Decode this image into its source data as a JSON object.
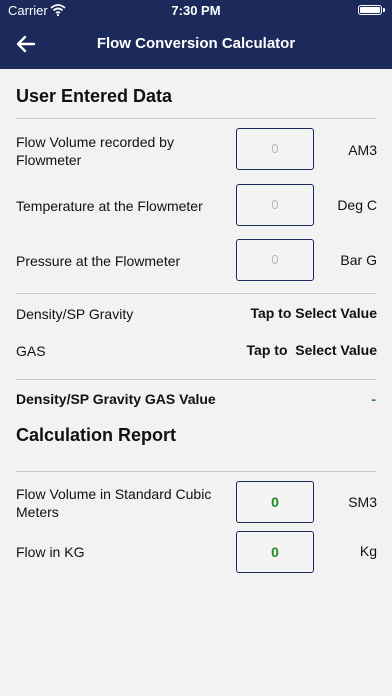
{
  "status_bar": {
    "carrier": "Carrier",
    "time": "7:30 PM",
    "icons": [
      "wifi-icon",
      "battery-icon"
    ]
  },
  "nav": {
    "title": "Flow Conversion Calculator",
    "back_icon": "back-arrow-icon"
  },
  "user_data": {
    "heading": "User Entered Data",
    "flow_volume": {
      "label": "Flow Volume recorded by Flowmeter",
      "placeholder": "0",
      "unit": "AM3"
    },
    "temperature": {
      "label": "Temperature at the Flowmeter",
      "placeholder": "0",
      "unit": "Deg C"
    },
    "pressure": {
      "label": "Pressure at the Flowmeter",
      "placeholder": "0",
      "unit": "Bar G"
    },
    "density": {
      "label": "Density/SP Gravity",
      "value": "Tap to Select Value"
    },
    "gas": {
      "label": "GAS",
      "value": "Tap to  Select Value"
    },
    "density_gas_value": {
      "label": "Density/SP Gravity GAS Value",
      "value": "-"
    }
  },
  "report": {
    "heading": "Calculation Report",
    "flow_standard": {
      "label": "Flow Volume in Standard Cubic Meters",
      "value": "0",
      "unit": "SM3"
    },
    "flow_kg": {
      "label": "Flow in KG",
      "value": "0",
      "unit": "Kg"
    }
  },
  "colors": {
    "nav_background": "#1b2a5a",
    "result_green": "#1f8a1f",
    "page_background": "#f2f2f2"
  }
}
